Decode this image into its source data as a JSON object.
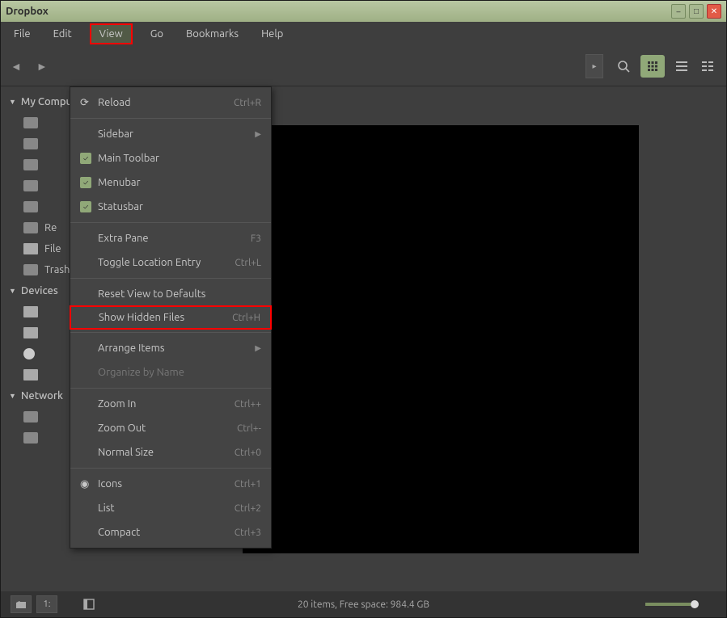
{
  "window": {
    "title": "Dropbox"
  },
  "menubar": {
    "file": "File",
    "edit": "Edit",
    "view": "View",
    "go": "Go",
    "bookmarks": "Bookmarks",
    "help": "Help"
  },
  "viewmenu": {
    "reload": "Reload",
    "reload_accel": "Ctrl+R",
    "sidebar": "Sidebar",
    "main_toolbar": "Main Toolbar",
    "menubar": "Menubar",
    "statusbar": "Statusbar",
    "extra_pane": "Extra Pane",
    "extra_pane_accel": "F3",
    "toggle_loc": "Toggle Location Entry",
    "toggle_loc_accel": "Ctrl+L",
    "reset": "Reset View to Defaults",
    "show_hidden": "Show Hidden Files",
    "show_hidden_accel": "Ctrl+H",
    "arrange": "Arrange Items",
    "organize": "Organize by Name",
    "zoom_in": "Zoom In",
    "zoom_in_accel": "Ctrl++",
    "zoom_out": "Zoom Out",
    "zoom_out_accel": "Ctrl+-",
    "normal": "Normal Size",
    "normal_accel": "Ctrl+0",
    "icons": "Icons",
    "icons_accel": "Ctrl+1",
    "list": "List",
    "list_accel": "Ctrl+2",
    "compact": "Compact",
    "compact_accel": "Ctrl+3"
  },
  "sidebar": {
    "section1": "My Computer",
    "items1": [
      "",
      "",
      "",
      "",
      "",
      "Re",
      "File",
      "Trash"
    ],
    "section2": "Devices",
    "section3": "Network"
  },
  "status": {
    "text": "20 items, Free space: 984.4 GB",
    "tree": "1:"
  }
}
